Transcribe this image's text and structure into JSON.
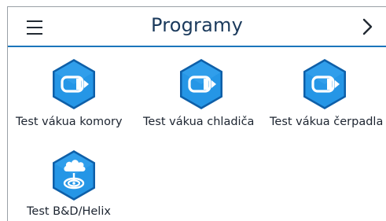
{
  "header": {
    "title": "Programy"
  },
  "icons": {
    "menu": "hamburger-menu-icon",
    "next": "chevron-right-icon",
    "vacuum": "vacuum-test-icon",
    "bd_helix": "bd-helix-test-icon"
  },
  "colors": {
    "accent": "#1b75bb",
    "icon_fill": "#1e8bd8",
    "icon_edge": "#0e5fa8"
  },
  "programs": [
    {
      "label": "Test vákua komory"
    },
    {
      "label": "Test vákua chladiča"
    },
    {
      "label": "Test vákua čerpadla"
    },
    {
      "label": "Test B&D/Helix"
    }
  ]
}
